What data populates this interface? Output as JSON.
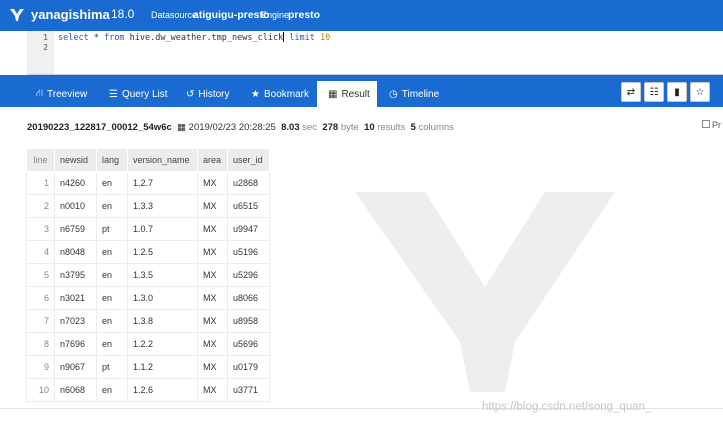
{
  "header": {
    "app_name": "yanagishima",
    "version": "18.0",
    "datasource_label": "Datasource",
    "datasource": "atiguigu-presto",
    "engine_label": "Engine",
    "engine": "presto"
  },
  "editor": {
    "line_numbers": [
      "1",
      "2"
    ],
    "code": {
      "select": "select",
      "star": " * ",
      "from": "from",
      "table": " hive.dw_weather.tmp_news_click",
      "limit": " limit",
      "count": " 10"
    }
  },
  "tabs": [
    {
      "label": "Treeview",
      "icon": "sitemap-icon",
      "glyph": "⛙"
    },
    {
      "label": "Query List",
      "icon": "list-icon",
      "glyph": "☰"
    },
    {
      "label": "History",
      "icon": "history-icon",
      "glyph": "↺"
    },
    {
      "label": "Bookmark",
      "icon": "star-icon",
      "glyph": "★"
    },
    {
      "label": "Result",
      "icon": "table-icon",
      "glyph": "▦",
      "active": true
    },
    {
      "label": "Timeline",
      "icon": "clock-icon",
      "glyph": "◷"
    }
  ],
  "toolbar": [
    {
      "icon": "swap-icon",
      "glyph": "⇄"
    },
    {
      "icon": "indent-icon",
      "glyph": "☷"
    },
    {
      "icon": "clipboard-icon",
      "glyph": "▮"
    },
    {
      "icon": "star-outline-icon",
      "glyph": "☆"
    }
  ],
  "result_meta": {
    "query_id": "20190223_122817_00012_54w6c",
    "timestamp": "2019/02/23 20:28:25",
    "elapsed": "8.03",
    "elapsed_unit": "sec",
    "size": "278",
    "size_unit": "byte",
    "results": "10",
    "results_label": "results",
    "columns": "5",
    "columns_label": "columns",
    "pretty_label": "Pr"
  },
  "table": {
    "headers": [
      "line",
      "newsid",
      "lang",
      "version_name",
      "area",
      "user_id"
    ],
    "rows": [
      [
        "1",
        "n4260",
        "en",
        "1.2.7",
        "MX",
        "u2868"
      ],
      [
        "2",
        "n0010",
        "en",
        "1.3.3",
        "MX",
        "u6515"
      ],
      [
        "3",
        "n6759",
        "pt",
        "1.0.7",
        "MX",
        "u9947"
      ],
      [
        "4",
        "n8048",
        "en",
        "1.2.5",
        "MX",
        "u5196"
      ],
      [
        "5",
        "n3795",
        "en",
        "1.3.5",
        "MX",
        "u5296"
      ],
      [
        "6",
        "n3021",
        "en",
        "1.3.0",
        "MX",
        "u8066"
      ],
      [
        "7",
        "n7023",
        "en",
        "1.3.8",
        "MX",
        "u8958"
      ],
      [
        "8",
        "n7696",
        "en",
        "1.2.2",
        "MX",
        "u5696"
      ],
      [
        "9",
        "n9067",
        "pt",
        "1.1.2",
        "MX",
        "u0179"
      ],
      [
        "10",
        "n6068",
        "en",
        "1.2.6",
        "MX",
        "u3771"
      ]
    ]
  },
  "credit": "https://blog.csdn.net/song_quan_",
  "colors": {
    "brand": "#1a6bd1",
    "header_row": "#ececec",
    "watermark": "#eeeeee"
  }
}
